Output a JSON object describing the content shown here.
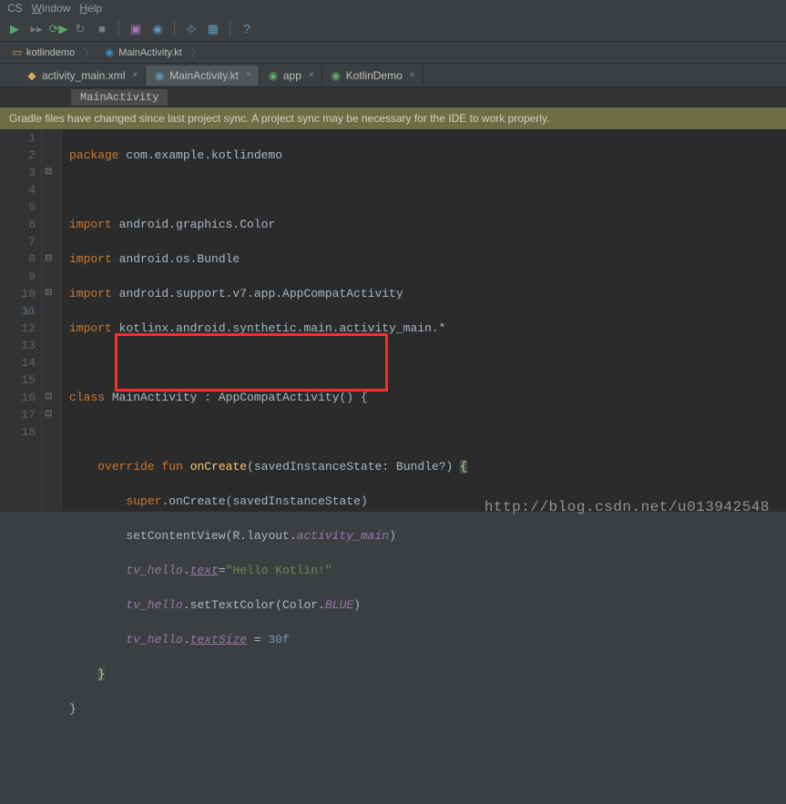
{
  "menu": {
    "vcs": "CS",
    "window": "Window",
    "help": "Help"
  },
  "breadcrumb": {
    "folder": "kotlindemo",
    "file": "MainActivity.kt"
  },
  "tabs": [
    {
      "label": "activity_main.xml",
      "active": false,
      "icon": "xml"
    },
    {
      "label": "MainActivity.kt",
      "active": true,
      "icon": "kt"
    },
    {
      "label": "app",
      "active": false,
      "icon": "gradle"
    },
    {
      "label": "KotlinDemo",
      "active": false,
      "icon": "gradle"
    }
  ],
  "structure_crumb": "MainActivity",
  "banner": "Gradle files have changed since last project sync. A project sync may be necessary for the IDE to work properly.",
  "line_numbers": [
    "1",
    "2",
    "3",
    "4",
    "5",
    "6",
    "7",
    "8",
    "9",
    "10",
    "11",
    "12",
    "13",
    "14",
    "15",
    "16",
    "17",
    "18"
  ],
  "code": {
    "l1": {
      "kw": "package",
      "rest": " com.example.kotlindemo"
    },
    "l3": {
      "kw": "import",
      "rest": " android.graphics.Color"
    },
    "l4": {
      "kw": "import",
      "rest": " android.os.Bundle"
    },
    "l5": {
      "kw": "import",
      "rest": " android.support.v7.app.AppCompatActivity"
    },
    "l6": {
      "kw": "import",
      "rest": " kotlinx.android.synthetic.main.activity_main.*"
    },
    "l8": {
      "kw": "class",
      "name": " MainActivity : AppCompatActivity() {"
    },
    "l10": {
      "kw1": "override",
      "kw2": "fun",
      "fn": "onCreate",
      "params": "(savedInstanceState: Bundle?) ",
      "brace": "{"
    },
    "l11": {
      "kw": "super",
      "rest": ".onCreate(savedInstanceState)"
    },
    "l12": {
      "pre": "setContentView(R.layout.",
      "ident": "activity_main",
      "post": ")"
    },
    "l13": {
      "obj": "tv_hello",
      "prop": "text",
      "eq": "=",
      "str": "\"Hello Kotlin!\""
    },
    "l14": {
      "obj": "tv_hello",
      "call": ".setTextColor(Color.",
      "prop": "BLUE",
      "post": ")"
    },
    "l15": {
      "obj": "tv_hello",
      "prop": "textSize",
      "eq": " = ",
      "num": "30f"
    },
    "l16": {
      "brace": "}"
    },
    "l17": {
      "brace": "}"
    }
  },
  "watermark": "http://blog.csdn.net/u013942548"
}
